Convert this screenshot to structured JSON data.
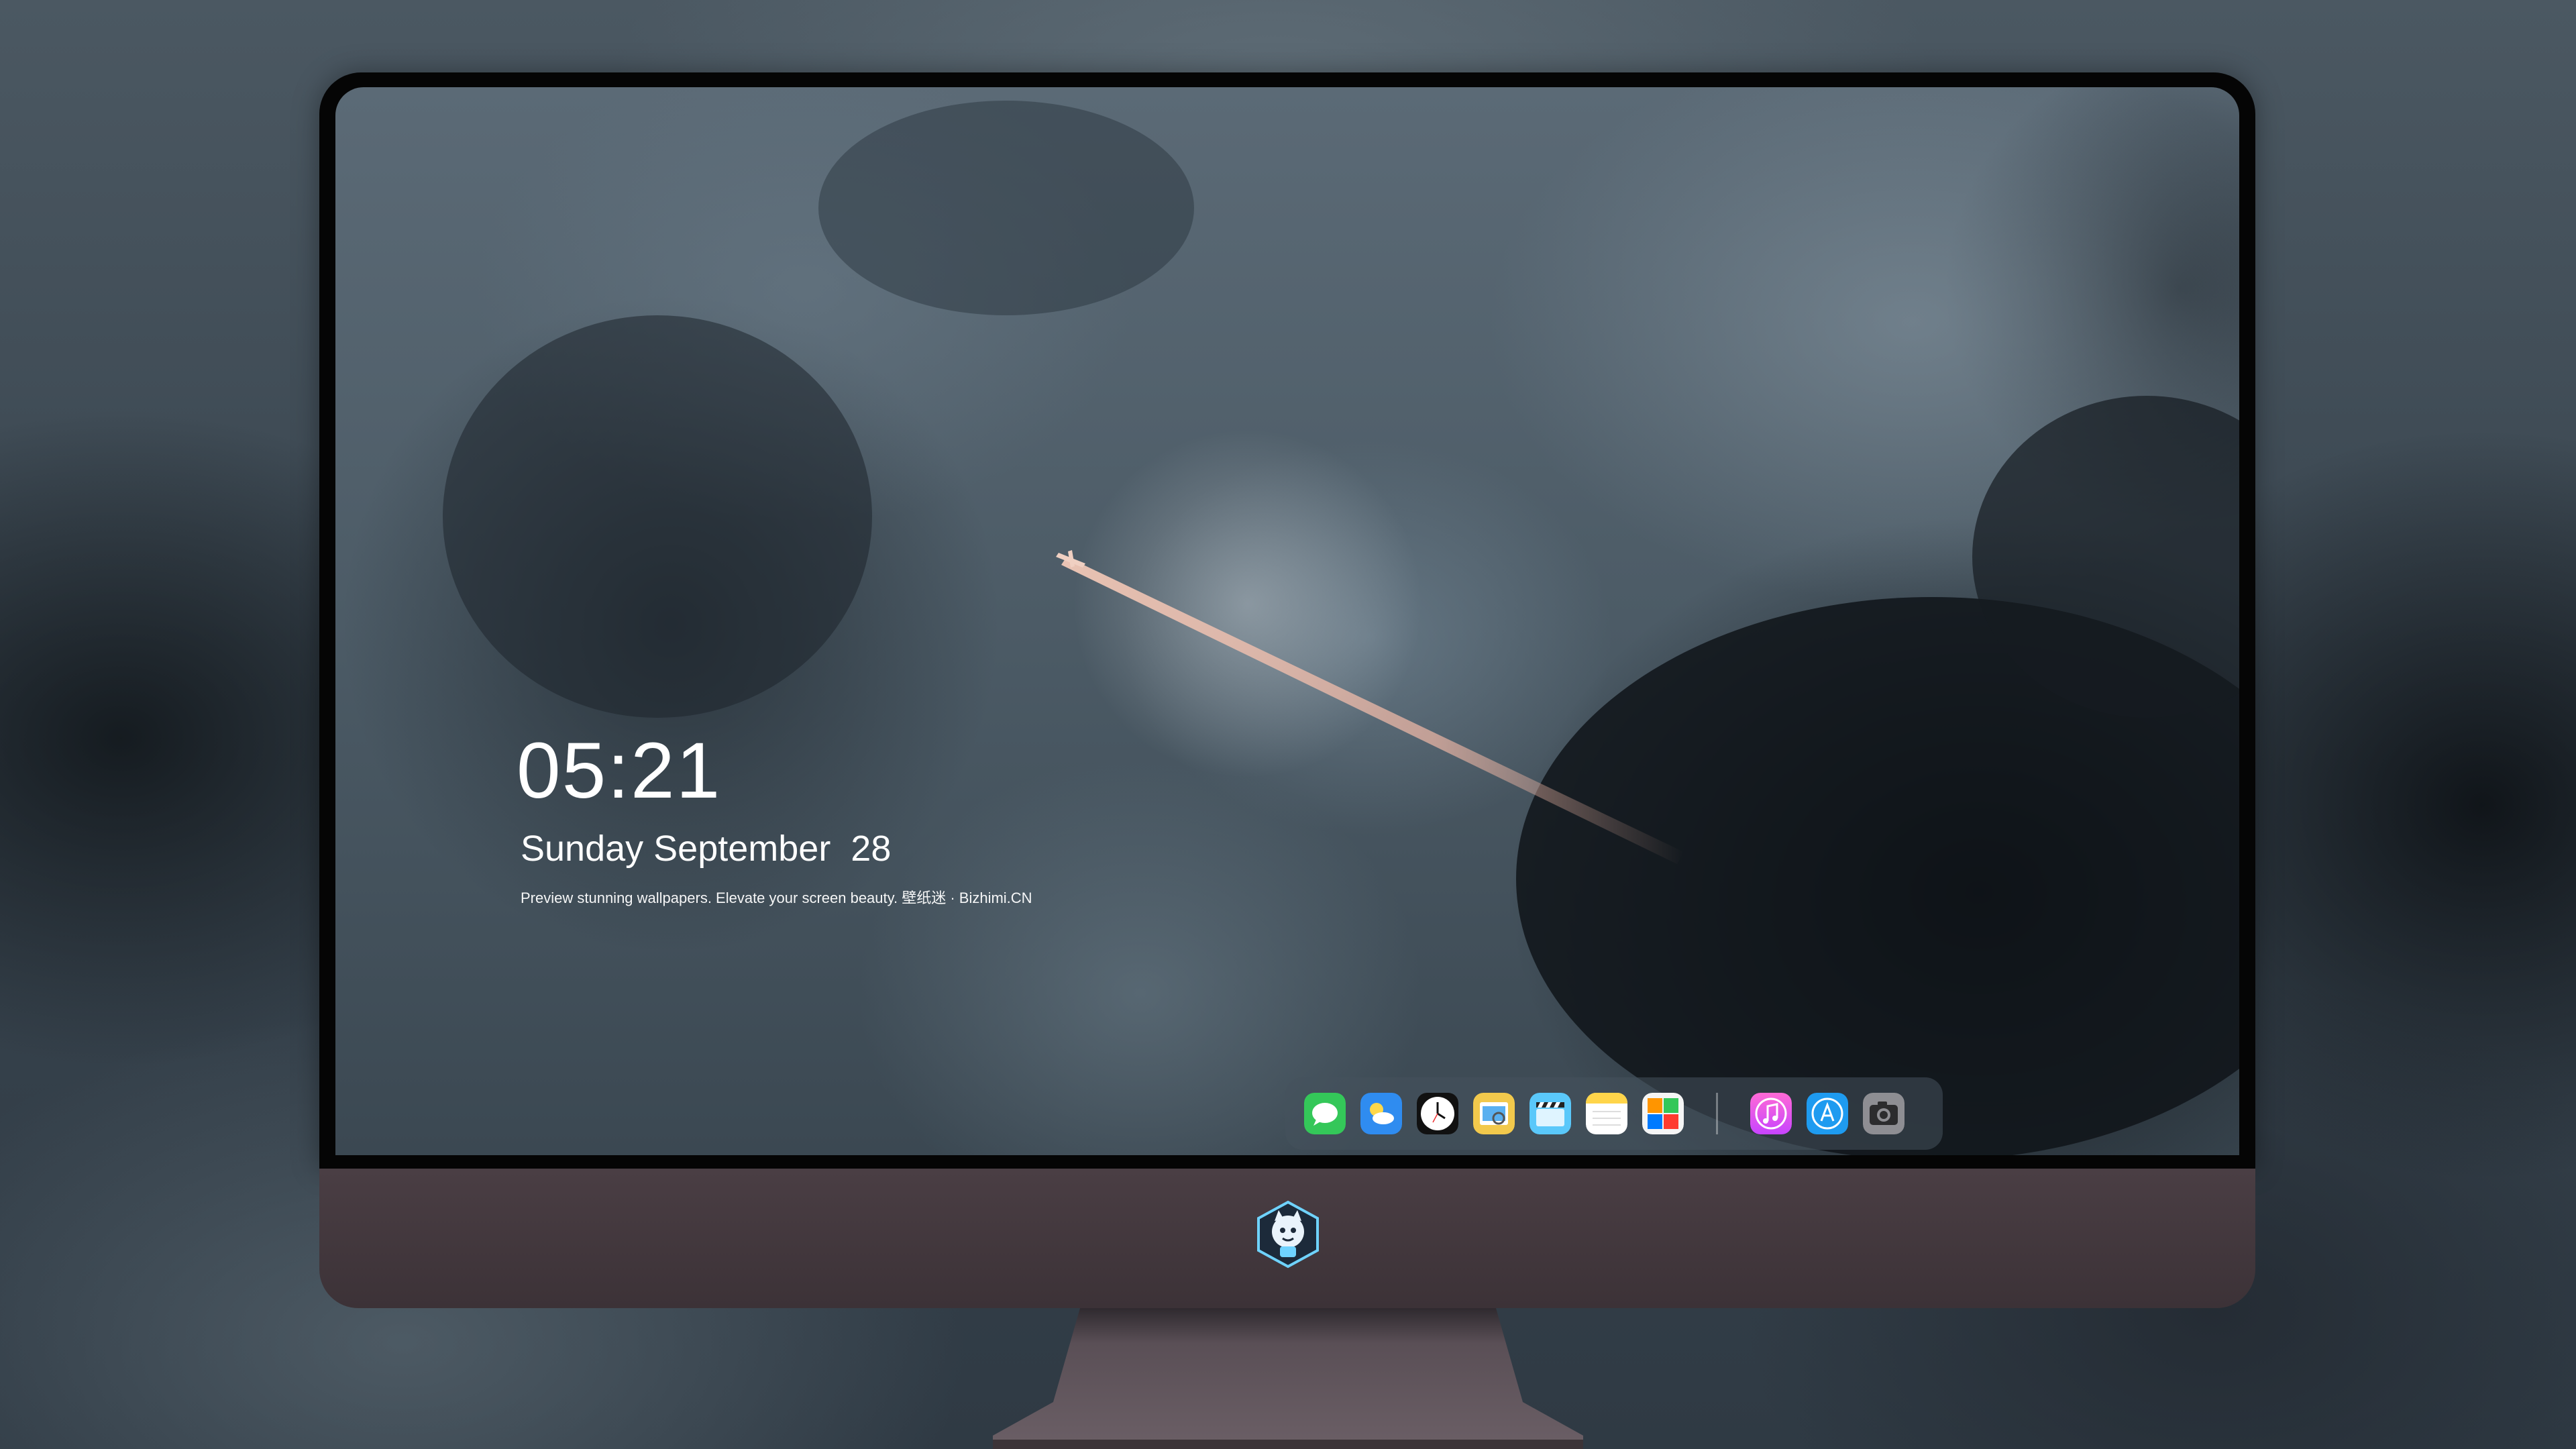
{
  "clock": {
    "time": "05:21",
    "date": "Sunday September  28",
    "caption": "Preview stunning wallpapers. Elevate your screen beauty. 壁纸迷 · Bizhimi.CN"
  },
  "dock": {
    "apps": [
      {
        "name": "messages-icon",
        "color": "#34c759"
      },
      {
        "name": "weather-icon",
        "color": "#2f8cf0"
      },
      {
        "name": "clock-icon",
        "color": "#111111"
      },
      {
        "name": "preview-icon",
        "color": "#f2c94c"
      },
      {
        "name": "clapperboard-icon",
        "color": "#5ac8fa"
      },
      {
        "name": "notes-icon",
        "color": "#ffd54a"
      },
      {
        "name": "photo-grid-icon",
        "color": "#4cd964"
      },
      {
        "name": "music-icon",
        "color": "#ff4fd8"
      },
      {
        "name": "app-store-icon",
        "color": "#1e9bf0"
      },
      {
        "name": "camera-icon",
        "color": "#8e8e93"
      }
    ]
  },
  "colors": {
    "monitor_chin": "#4a3e44",
    "bezel": "#050505",
    "clock_text": "#ffffff"
  }
}
